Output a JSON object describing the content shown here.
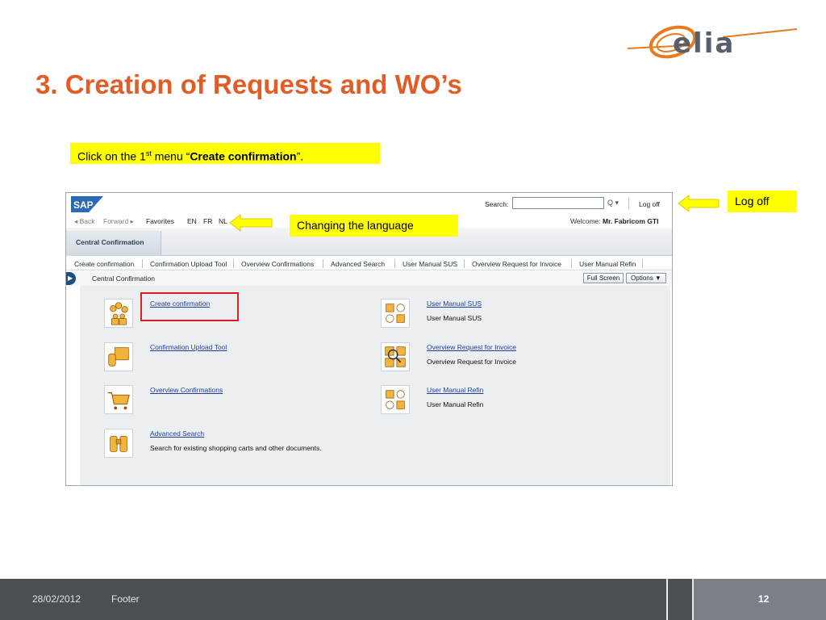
{
  "logo": {
    "text": "elia"
  },
  "slide": {
    "title": "3. Creation of Requests and WO’s"
  },
  "notes": {
    "create_prefix": "Click on the 1",
    "create_sup": "st",
    "create_mid": " menu “",
    "create_bold": "Create confirmation",
    "create_suffix": "”.",
    "language": "Changing the language",
    "logoff": "Log off"
  },
  "sap": {
    "top": {
      "search_label": "Search:",
      "search_value": "",
      "search_go": "Q ▾",
      "logoff": "Log off"
    },
    "nav": {
      "back": "◂ Back",
      "forward": "Forward ▸",
      "favorites": "Favorites",
      "lang_en": "EN",
      "lang_fr": "FR",
      "lang_nl": "NL",
      "welcome_prefix": "Welcome: ",
      "welcome_name": "Mr. Fabricom GTI"
    },
    "active_tab": "Central Confirmation",
    "subnav": [
      "Create confirmation",
      "Confirmation Upload Tool",
      "Overview Confirmations",
      "Advanced Search",
      "User Manual SUS",
      "Overview Request for Invoice",
      "User Manual Refin"
    ],
    "crumb": {
      "expander": "▶",
      "text": "Central Confirmation",
      "fullscreen": "Full Screen",
      "options": "Options ▼"
    },
    "tiles": [
      {
        "link": "Create confirmation",
        "desc": ""
      },
      {
        "link": "Confirmation Upload Tool",
        "desc": ""
      },
      {
        "link": "Overview Confirmations",
        "desc": ""
      },
      {
        "link": "Advanced Search",
        "desc": "Search for existing shopping carts and other documents."
      },
      {
        "link": "User Manual SUS",
        "desc": "User Manual SUS"
      },
      {
        "link": "Overview Request for Invoice",
        "desc": "Overview Request for Invoice"
      },
      {
        "link": "User Manual Refin",
        "desc": "User Manual Refin"
      }
    ]
  },
  "footer": {
    "date": "28/02/2012",
    "text": "Footer",
    "page": "12"
  },
  "colors": {
    "title": "#e05d26",
    "highlight": "#ffff00",
    "footer": "#4a4f54",
    "link": "#1f3f9a",
    "red_box": "#e02020"
  }
}
